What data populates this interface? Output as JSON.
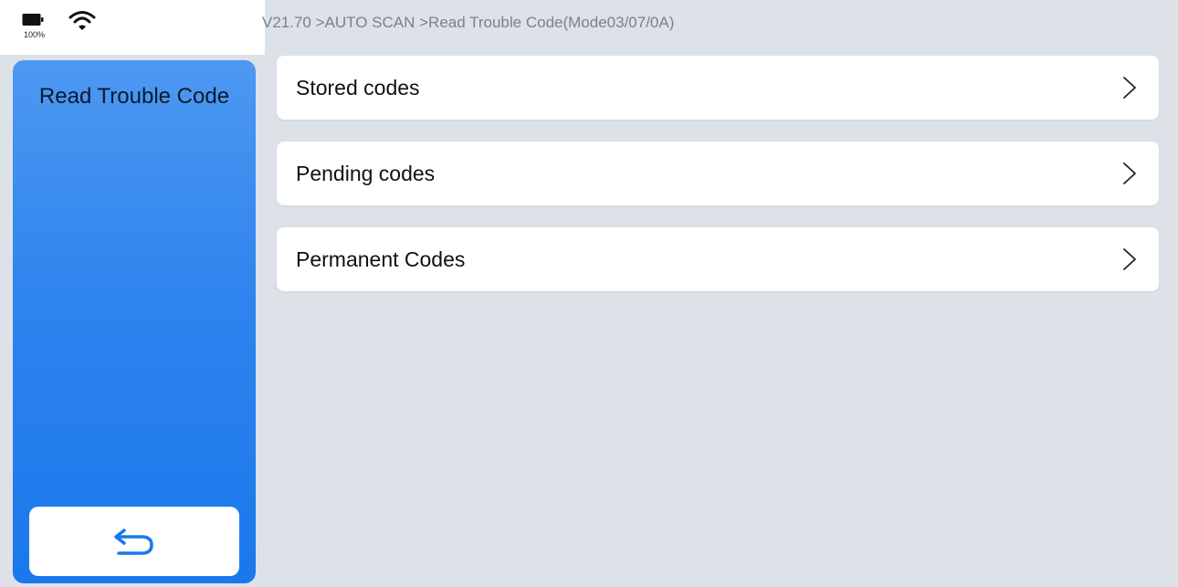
{
  "status": {
    "battery_percent": "100%",
    "battery_icon": "battery-full-icon",
    "wifi_icon": "wifi-icon"
  },
  "sidebar": {
    "title": "Read Trouble Code",
    "back_icon": "back-arrow-icon",
    "accent_top": "#4d98f2",
    "accent_bottom": "#1a78ec"
  },
  "breadcrumb": "V21.70 >AUTO SCAN >Read Trouble Code(Mode03/07/0A)",
  "menu": {
    "items": [
      {
        "label": "Stored codes"
      },
      {
        "label": "Pending codes"
      },
      {
        "label": "Permanent Codes"
      }
    ],
    "chevron_icon": "chevron-right-icon"
  },
  "colors": {
    "background": "#dde1e8",
    "card": "#ffffff",
    "breadcrumb_text": "#7c8089"
  }
}
